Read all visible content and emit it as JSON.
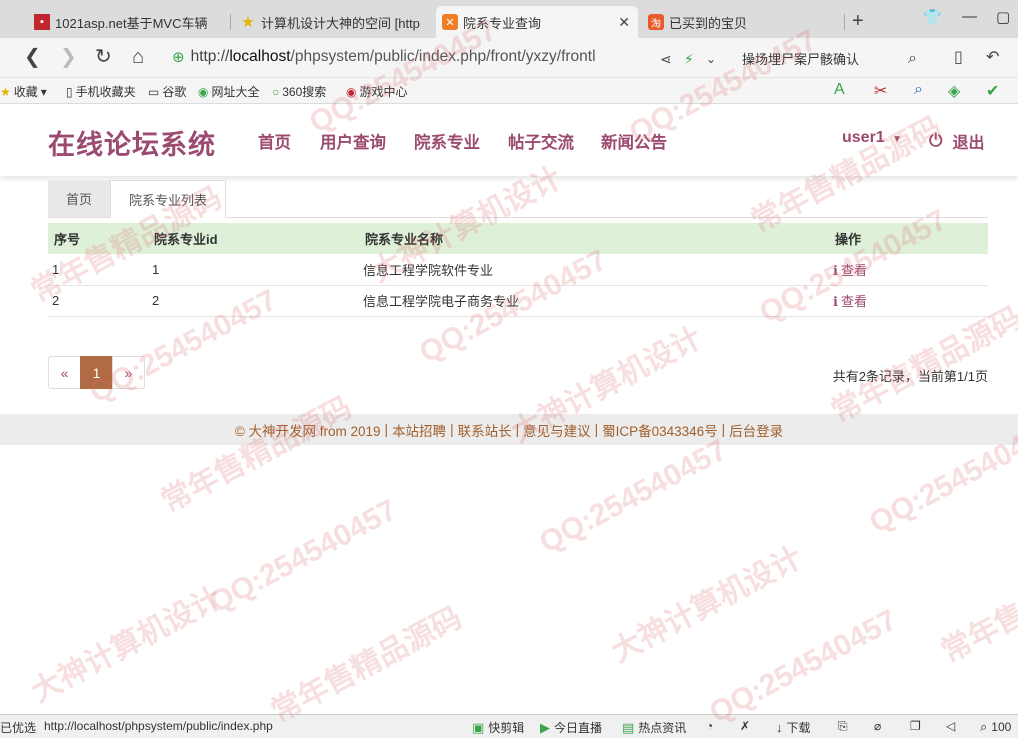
{
  "browser": {
    "tabs": [
      {
        "title": "1021asp.net基于MVC车辆",
        "icon": "red-square-icon"
      },
      {
        "title": "计算机设计大神的空间 [http",
        "icon": "star-icon"
      },
      {
        "title": "院系专业查询",
        "icon": "xampp-icon"
      },
      {
        "title": "已买到的宝贝",
        "icon": "taobao-icon"
      }
    ],
    "url_prefix": "http://",
    "url_host": "localhost",
    "url_path": "/phpsystem/public/index.php/front/yxzy/frontl",
    "search_text": "操场埋尸案尸骸确认",
    "bookmarks": [
      "收藏",
      "手机收藏夹",
      "谷歌",
      "网址大全",
      "360搜索",
      "游戏中心"
    ],
    "status_left": "已优选",
    "status_url": "http://localhost/phpsystem/public/index.php",
    "status_items": [
      "快剪辑",
      "今日直播",
      "热点资讯",
      "下载",
      "100"
    ]
  },
  "site": {
    "logo": "在线论坛系统",
    "nav": [
      "首页",
      "用户查询",
      "院系专业",
      "帖子交流",
      "新闻公告"
    ],
    "user": "user1",
    "logout": "退出"
  },
  "breadcrumb": {
    "home": "首页",
    "current": "院系专业列表"
  },
  "table": {
    "headers": [
      "序号",
      "院系专业id",
      "院系专业名称",
      "操作"
    ],
    "rows": [
      {
        "no": "1",
        "id": "1",
        "name": "信息工程学院软件专业",
        "action": "查看"
      },
      {
        "no": "2",
        "id": "2",
        "name": "信息工程学院电子商务专业",
        "action": "查看"
      }
    ]
  },
  "pagination": {
    "prev": "«",
    "current": "1",
    "next": "»",
    "summary": "共有2条记录，当前第1/1页"
  },
  "footer": {
    "items": [
      "© 大神开发网 from 2019",
      "本站招聘",
      "联系站长",
      "意见与建议",
      "蜀ICP备0343346号",
      "后台登录"
    ]
  },
  "watermark": {
    "lines": [
      "QQ:254540457",
      "常年售精品源码",
      "大神计算机设计"
    ]
  },
  "colors": {
    "brand": "#9b4a70",
    "table_header": "#dff0d8",
    "page_active": "#b06a44",
    "footer_link": "#a0602e"
  }
}
